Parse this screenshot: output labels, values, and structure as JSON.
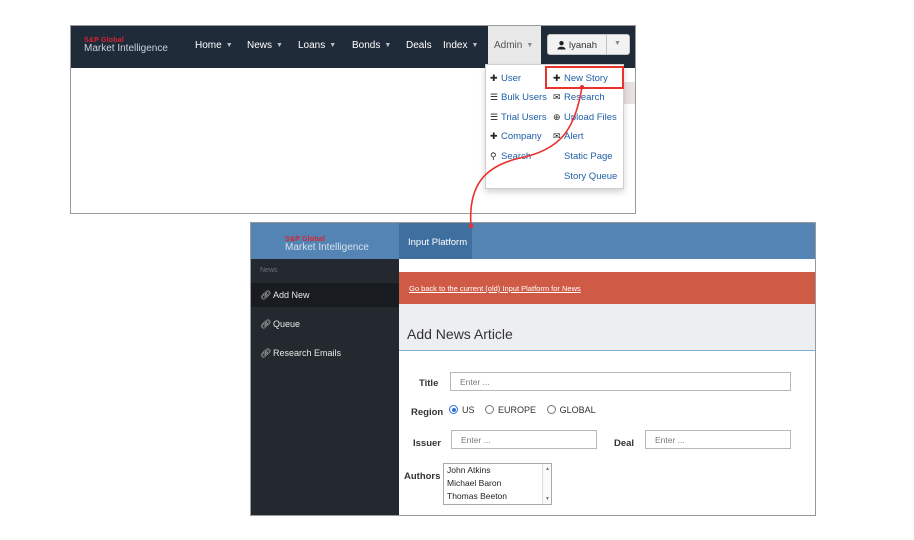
{
  "top_screen": {
    "logo": {
      "brand": "S&P Global",
      "subtitle": "Market Intelligence"
    },
    "nav": [
      {
        "label": "Home",
        "has_caret": true
      },
      {
        "label": "News",
        "has_caret": true
      },
      {
        "label": "Loans",
        "has_caret": true
      },
      {
        "label": "Bonds",
        "has_caret": true
      },
      {
        "label": "Deals",
        "has_caret": false
      },
      {
        "label": "Index",
        "has_caret": true
      }
    ],
    "admin": {
      "label": "Admin"
    },
    "user": {
      "name": "lyanah"
    },
    "dropdown": {
      "left_column": [
        {
          "icon": "plus-icon",
          "label": "User"
        },
        {
          "icon": "list-icon",
          "label": "Bulk Users"
        },
        {
          "icon": "list-icon",
          "label": "Trial Users"
        },
        {
          "icon": "plus-icon",
          "label": "Company"
        },
        {
          "icon": "search-icon",
          "label": "Search"
        }
      ],
      "right_column": [
        {
          "icon": "plus-icon",
          "label": "New Story"
        },
        {
          "icon": "envelope-icon",
          "label": "Research"
        },
        {
          "icon": "upload-icon",
          "label": "Upload Files"
        },
        {
          "icon": "envelope-icon",
          "label": "Alert"
        },
        {
          "icon": "",
          "label": "Static Page"
        },
        {
          "icon": "",
          "label": "Story Queue"
        }
      ],
      "highlighted": "New Story"
    },
    "colors": {
      "nav_bg": "#202b3a",
      "brand_red": "#d8242f",
      "link_blue": "#1f5fa8",
      "highlight_red": "#e8322c"
    }
  },
  "bottom_screen": {
    "logo": {
      "brand": "S&P Global",
      "subtitle": "Market Intelligence"
    },
    "nav_tab": "Input Platform",
    "sidebar": {
      "section": "News",
      "items": [
        {
          "label": "Add New",
          "active": true
        },
        {
          "label": "Queue",
          "active": false
        },
        {
          "label": "Research Emails",
          "active": false
        }
      ]
    },
    "alert_link": "Go back to the current (old) Input Platform for News",
    "page_title": "Add News Article",
    "form": {
      "title": {
        "label": "Title",
        "placeholder": "Enter ..."
      },
      "region": {
        "label": "Region",
        "options": [
          "US",
          "EUROPE",
          "GLOBAL"
        ],
        "selected": "US"
      },
      "issuer": {
        "label": "Issuer",
        "placeholder": "Enter ..."
      },
      "deal": {
        "label": "Deal",
        "placeholder": "Enter ..."
      },
      "authors": {
        "label": "Authors",
        "options": [
          "John Atkins",
          "Michael Baron",
          "Thomas Beeton"
        ]
      }
    },
    "colors": {
      "nav_bg": "#5384b3",
      "sidebar_bg": "#23292e",
      "alert_bg": "#cf5a45"
    }
  }
}
